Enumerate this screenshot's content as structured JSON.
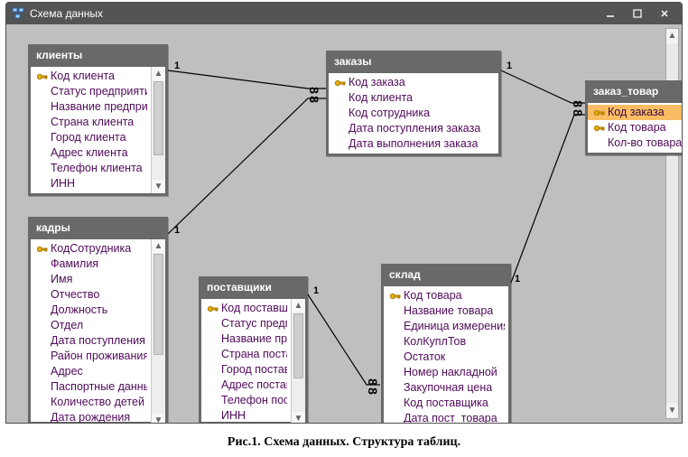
{
  "window": {
    "title": "Схема данных"
  },
  "caption": "Рис.1. Схема данных. Структура таблиц.",
  "tables": {
    "clients": {
      "title": "клиенты",
      "fields": [
        {
          "key": true,
          "label": "Код клиента"
        },
        {
          "key": false,
          "label": "Статус предприяти"
        },
        {
          "key": false,
          "label": "Название предпри"
        },
        {
          "key": false,
          "label": "Страна клиента"
        },
        {
          "key": false,
          "label": "Город клиента"
        },
        {
          "key": false,
          "label": "Адрес клиента"
        },
        {
          "key": false,
          "label": "Телефон клиента"
        },
        {
          "key": false,
          "label": "ИНН"
        }
      ]
    },
    "orders": {
      "title": "заказы",
      "fields": [
        {
          "key": true,
          "label": "Код заказа"
        },
        {
          "key": false,
          "label": "Код клиента"
        },
        {
          "key": false,
          "label": "Код сотрудника"
        },
        {
          "key": false,
          "label": "Дата поступления заказа"
        },
        {
          "key": false,
          "label": "Дата выполнения заказа"
        }
      ]
    },
    "order_item": {
      "title": "заказ_товар",
      "fields": [
        {
          "key": true,
          "label": "Код заказа",
          "selected": true
        },
        {
          "key": true,
          "label": "Код товара"
        },
        {
          "key": false,
          "label": "Кол-во товара в за"
        }
      ]
    },
    "staff": {
      "title": "кадры",
      "fields": [
        {
          "key": true,
          "label": "КодСотрудника"
        },
        {
          "key": false,
          "label": "Фамилия"
        },
        {
          "key": false,
          "label": "Имя"
        },
        {
          "key": false,
          "label": "Отчество"
        },
        {
          "key": false,
          "label": "Должность"
        },
        {
          "key": false,
          "label": "Отдел"
        },
        {
          "key": false,
          "label": "Дата поступления"
        },
        {
          "key": false,
          "label": "Район проживания"
        },
        {
          "key": false,
          "label": "Адрес"
        },
        {
          "key": false,
          "label": "Паспортные данные"
        },
        {
          "key": false,
          "label": "Количество детей"
        },
        {
          "key": false,
          "label": "Дата рождения"
        }
      ]
    },
    "suppliers": {
      "title": "поставщики",
      "fields": [
        {
          "key": true,
          "label": "Код поставщ"
        },
        {
          "key": false,
          "label": "Статус предп"
        },
        {
          "key": false,
          "label": "Название пре"
        },
        {
          "key": false,
          "label": "Страна поста"
        },
        {
          "key": false,
          "label": "Город постав"
        },
        {
          "key": false,
          "label": "Адрес постав"
        },
        {
          "key": false,
          "label": "Телефон пос"
        },
        {
          "key": false,
          "label": "ИНН"
        }
      ]
    },
    "stock": {
      "title": "склад",
      "fields": [
        {
          "key": true,
          "label": "Код товара"
        },
        {
          "key": false,
          "label": "Название товара"
        },
        {
          "key": false,
          "label": "Единица измерения"
        },
        {
          "key": false,
          "label": "КолКуплТов"
        },
        {
          "key": false,
          "label": "Остаток"
        },
        {
          "key": false,
          "label": "Номер накладной"
        },
        {
          "key": false,
          "label": "Закупочная цена"
        },
        {
          "key": false,
          "label": "Код поставщика"
        },
        {
          "key": false,
          "label": "Дата пост_товара"
        }
      ]
    }
  },
  "relations": {
    "one": "1"
  }
}
